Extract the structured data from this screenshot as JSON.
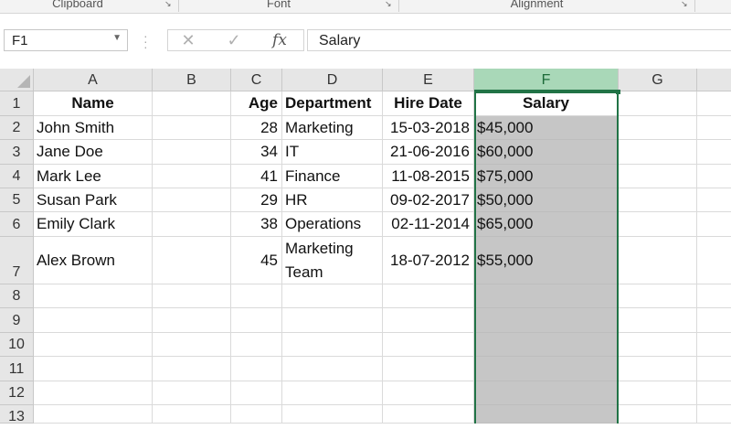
{
  "ribbon": {
    "groups": [
      "Clipboard",
      "Font",
      "Alignment"
    ]
  },
  "formula_bar": {
    "name_box": "F1",
    "cancel_symbol": "✕",
    "enter_symbol": "✓",
    "fx_symbol": "fx",
    "content": "Salary"
  },
  "sheet": {
    "columns": [
      "A",
      "B",
      "C",
      "D",
      "E",
      "F",
      "G"
    ],
    "selected_column": "F",
    "rows": [
      "1",
      "2",
      "3",
      "4",
      "5",
      "6",
      "7",
      "8",
      "9",
      "10",
      "11",
      "12",
      "13"
    ],
    "header": {
      "name": "Name",
      "age": "Age",
      "department": "Department",
      "hire_date": "Hire Date",
      "salary": "Salary"
    },
    "records": [
      {
        "name": "John Smith",
        "age": "28",
        "department": "Marketing",
        "hire_date": "15-03-2018",
        "salary": "$45,000"
      },
      {
        "name": "Jane Doe",
        "age": "34",
        "department": "IT",
        "hire_date": "21-06-2016",
        "salary": "$60,000"
      },
      {
        "name": "Mark Lee",
        "age": "41",
        "department": "Finance",
        "hire_date": "11-08-2015",
        "salary": "$75,000"
      },
      {
        "name": "Susan Park",
        "age": "29",
        "department": "HR",
        "hire_date": "09-02-2017",
        "salary": "$50,000"
      },
      {
        "name": "Emily Clark",
        "age": "38",
        "department": "Operations",
        "hire_date": "02-11-2014",
        "salary": "$65,000"
      },
      {
        "name": "Alex Brown",
        "age": "45",
        "department": "Marketing Team",
        "hire_date": "18-07-2012",
        "salary": "$55,000"
      }
    ]
  },
  "colors": {
    "accent": "#217346",
    "selection_fill": "#c6c6c6",
    "header_selected": "#a9d8b8"
  }
}
